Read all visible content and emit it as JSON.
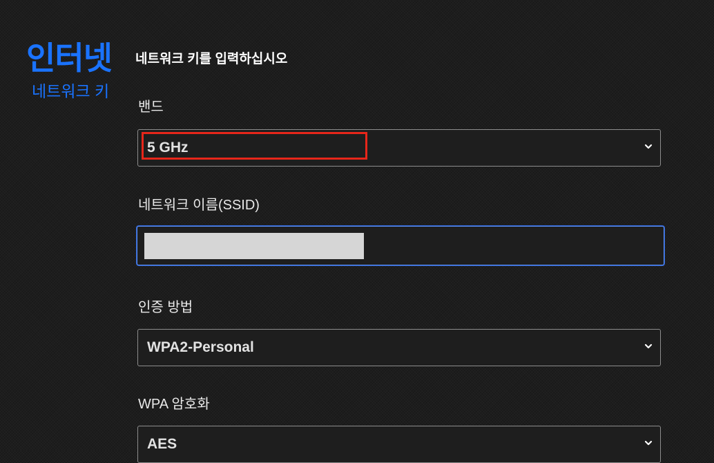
{
  "sidebar": {
    "title": "인터넷",
    "subtitle": "네트워크 키"
  },
  "main": {
    "heading": "네트워크 키를 입력하십시오",
    "band": {
      "label": "밴드",
      "selected": "5 GHz"
    },
    "ssid": {
      "label": "네트워크 이름(SSID)",
      "value": ""
    },
    "auth": {
      "label": "인증 방법",
      "selected": "WPA2-Personal"
    },
    "encryption": {
      "label": "WPA 암호화",
      "selected": "AES"
    }
  },
  "colors": {
    "accent": "#1a73ff",
    "highlight": "#e8261a",
    "background": "#1d1d1d",
    "focus_border": "#5b8ef0"
  },
  "icons": {
    "select_arrow": "chevron-down-icon"
  }
}
